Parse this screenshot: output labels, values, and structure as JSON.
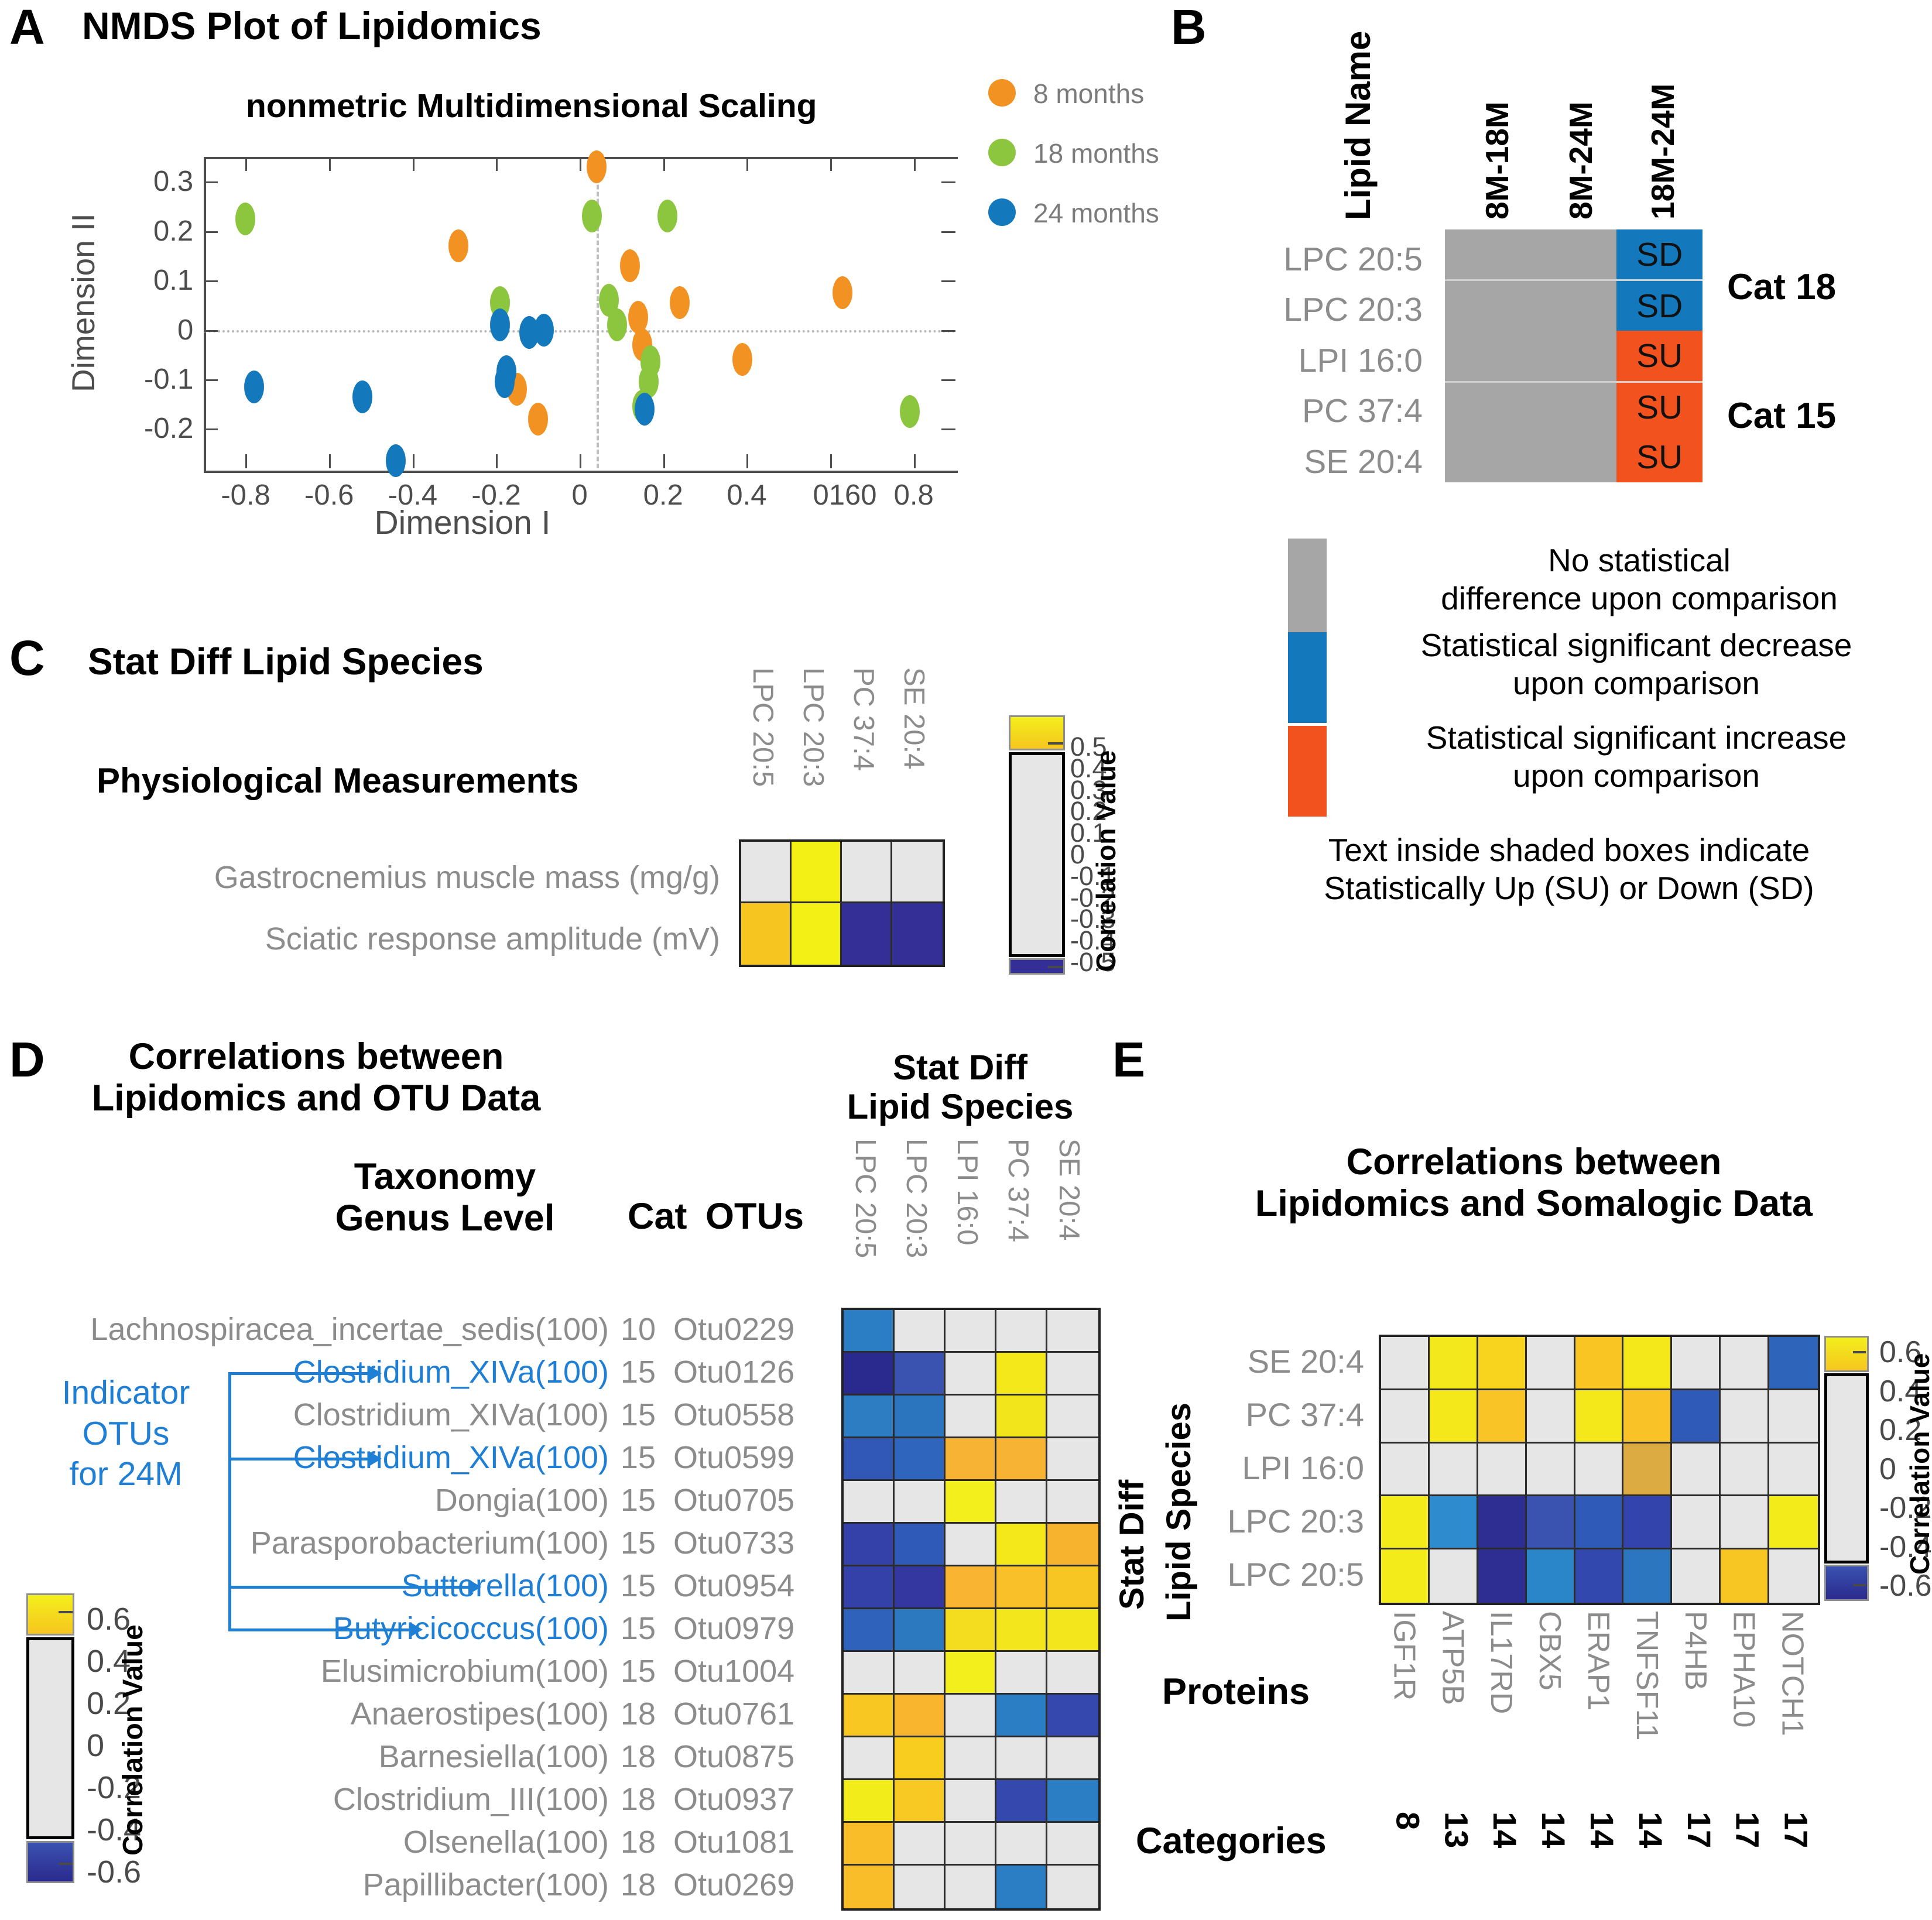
{
  "panels": {
    "a": {
      "letter": "A",
      "title": "NMDS Plot of Lipidomics",
      "subtitle": "nonmetric Multidimensional Scaling",
      "xlabel": "Dimension I",
      "ylabel": "Dimension II",
      "xticks": [
        "-0.8",
        "-0.6",
        "-0.4",
        "-0.2",
        "0",
        "0.2",
        "0.4",
        "0160",
        "0.8"
      ],
      "yticks": [
        "0.3",
        "0.2",
        "0.1",
        "0",
        "-0.1",
        "-0.2"
      ],
      "legend": [
        {
          "label": "8 months",
          "color": "#f29222"
        },
        {
          "label": "18 months",
          "color": "#8cc63e"
        },
        {
          "label": "24 months",
          "color": "#1479bc"
        }
      ]
    },
    "b": {
      "letter": "B",
      "row_header": "Lipid Name",
      "columns": [
        "8M-18M",
        "8M-24M",
        "18M-24M"
      ],
      "rows": [
        {
          "lipid": "LPC 20:5",
          "cells": [
            {
              "v": "",
              "s": "ns"
            },
            {
              "v": "",
              "s": "ns"
            },
            {
              "v": "SD",
              "s": "down"
            }
          ]
        },
        {
          "lipid": "LPC 20:3",
          "cells": [
            {
              "v": "",
              "s": "ns"
            },
            {
              "v": "",
              "s": "ns"
            },
            {
              "v": "SD",
              "s": "down"
            }
          ]
        },
        {
          "lipid": "LPI 16:0",
          "cells": [
            {
              "v": "",
              "s": "ns"
            },
            {
              "v": "",
              "s": "ns"
            },
            {
              "v": "SU",
              "s": "up"
            }
          ]
        },
        {
          "lipid": "PC 37:4",
          "cells": [
            {
              "v": "",
              "s": "ns"
            },
            {
              "v": "",
              "s": "ns"
            },
            {
              "v": "SU",
              "s": "up"
            }
          ]
        },
        {
          "lipid": "SE 20:4",
          "cells": [
            {
              "v": "",
              "s": "ns"
            },
            {
              "v": "",
              "s": "ns"
            },
            {
              "v": "SU",
              "s": "up"
            }
          ]
        }
      ],
      "cat_labels": [
        {
          "text": "Cat 18",
          "row": 0
        },
        {
          "text": "Cat 15",
          "row": 3
        }
      ],
      "legend": [
        {
          "color": "#a6a6a6",
          "text": "No statistical\ndifference upon comparison"
        },
        {
          "color": "#1479bc",
          "text": "Statistical significant decrease\nupon comparison"
        },
        {
          "color": "#f2521d",
          "text": "Statistical significant increase\nupon comparison"
        }
      ],
      "footnote": "Text inside shaded boxes indicate\nStatistically Up (SU) or Down (SD)"
    },
    "c": {
      "letter": "C",
      "title": "Stat Diff Lipid Species",
      "row_group_title": "Physiological Measurements",
      "colorbar_title": "Correlation Value",
      "colorbar_ticks": [
        "0.5",
        "0.4",
        "0.3",
        "0.2",
        "0.1",
        "0",
        "-0.1",
        "-0.2",
        "-0.3",
        "-0.4",
        "-0.5"
      ]
    },
    "d": {
      "letter": "D",
      "title": "Correlations between\nLipidomics and OTU Data",
      "heatmap_title": "Stat Diff\nLipid Species",
      "taxonomy_header": "Taxonomy\nGenus Level",
      "cat_header": "Cat",
      "otu_header": "OTUs",
      "indicator_label": "Indicator\nOTUs\nfor 24M",
      "colorbar_title": "Correlation Value",
      "colorbar_ticks": [
        "0.6",
        "0.4",
        "0.2",
        "0",
        "-0.2",
        "-0.4",
        "-0.6"
      ]
    },
    "e": {
      "letter": "E",
      "title": "Correlations between\nLipidomics and Somalogic Data",
      "ylabel": "Stat Diff\nLipid Species",
      "proteins_label": "Proteins",
      "categories_label": "Categories",
      "colorbar_title": "Correlation Value",
      "colorbar_ticks": [
        "0.6",
        "0.4",
        "0.2",
        "0",
        "-0.2",
        "-0.4",
        "-0.6"
      ]
    }
  },
  "chart_data": [
    {
      "type": "scatter",
      "title": "nonmetric Multidimensional Scaling",
      "xlabel": "Dimension I",
      "ylabel": "Dimension II",
      "xlim": [
        -0.9,
        0.9
      ],
      "ylim": [
        -0.28,
        0.35
      ],
      "grid": false,
      "legend_position": "top-right",
      "series": [
        {
          "name": "8 months",
          "color": "#f29222",
          "points": [
            [
              0.04,
              0.33
            ],
            [
              -0.29,
              0.17
            ],
            [
              0.12,
              0.13
            ],
            [
              0.63,
              0.075
            ],
            [
              0.24,
              0.055
            ],
            [
              0.14,
              0.025
            ],
            [
              0.15,
              -0.03
            ],
            [
              0.39,
              -0.06
            ],
            [
              -0.15,
              -0.12
            ],
            [
              -0.1,
              -0.18
            ]
          ]
        },
        {
          "name": "18 months",
          "color": "#8cc63e",
          "points": [
            [
              -0.8,
              0.225
            ],
            [
              0.03,
              0.23
            ],
            [
              0.21,
              0.23
            ],
            [
              -0.19,
              0.055
            ],
            [
              0.07,
              0.06
            ],
            [
              0.09,
              0.01
            ],
            [
              0.17,
              -0.065
            ],
            [
              0.165,
              -0.105
            ],
            [
              0.15,
              -0.155
            ],
            [
              0.79,
              -0.165
            ]
          ]
        },
        {
          "name": "24 months",
          "color": "#1479bc",
          "points": [
            [
              -0.19,
              0.01
            ],
            [
              -0.12,
              -0.005
            ],
            [
              -0.085,
              0.0
            ],
            [
              -0.78,
              -0.115
            ],
            [
              -0.52,
              -0.135
            ],
            [
              -0.175,
              -0.085
            ],
            [
              -0.18,
              -0.105
            ],
            [
              0.155,
              -0.16
            ],
            [
              -0.44,
              -0.265
            ]
          ]
        }
      ]
    },
    {
      "type": "heatmap",
      "title": "Stat Diff Lipid Species",
      "xlabel": "",
      "ylabel": "Physiological Measurements",
      "columns": [
        "LPC 20:5",
        "LPC 20:3",
        "PC 37:4",
        "SE 20:4"
      ],
      "rows": [
        "Gastrocnemius muscle mass (mg/g)",
        "Sciatic response amplitude (mV)"
      ],
      "colorbar_label": "Correlation Value",
      "clim": [
        -0.5,
        0.5
      ],
      "cells": [
        [
          "#e6e6e6",
          "#f2f015",
          "#e6e6e6",
          "#e6e6e6"
        ],
        [
          "#f6c51f",
          "#f2f015",
          "#342f96",
          "#342f96"
        ]
      ]
    },
    {
      "type": "heatmap",
      "title": "Correlations between Lipidomics and OTU Data",
      "xlabel": "Stat Diff Lipid Species",
      "ylabel": "Taxonomy Genus Level",
      "columns": [
        "LPC 20:5",
        "LPC 20:3",
        "LPI 16:0",
        "PC 37:4",
        "SE 20:4"
      ],
      "colorbar_label": "Correlation Value",
      "clim": [
        -0.6,
        0.6
      ],
      "rows": [
        {
          "taxon": "Lachnospiracea_incertae_sedis(100)",
          "cat": "10",
          "otu": "Otu0229",
          "indicator": false,
          "cells": [
            "#2b7ec4",
            "#e6e6e6",
            "#e6e6e6",
            "#e6e6e6",
            "#e6e6e6"
          ]
        },
        {
          "taxon": "Clostridium_XIVa(100)",
          "cat": "15",
          "otu": "Otu0126",
          "indicator": true,
          "cells": [
            "#2a2a8e",
            "#3a52b0",
            "#e6e6e6",
            "#f5e81a",
            "#e6e6e6"
          ]
        },
        {
          "taxon": "Clostridium_XIVa(100)",
          "cat": "15",
          "otu": "Otu0558",
          "indicator": false,
          "cells": [
            "#2c7dc2",
            "#2a75bd",
            "#e6e6e6",
            "#f3e51c",
            "#e6e6e6"
          ]
        },
        {
          "taxon": "Clostridium_XIVa(100)",
          "cat": "15",
          "otu": "Otu0599",
          "indicator": true,
          "cells": [
            "#3158b7",
            "#2f65bc",
            "#f7b333",
            "#f7b333",
            "#e6e6e6"
          ]
        },
        {
          "taxon": "Dongia(100)",
          "cat": "15",
          "otu": "Otu0705",
          "indicator": false,
          "cells": [
            "#e6e6e6",
            "#e6e6e6",
            "#f3ef1d",
            "#e6e6e6",
            "#e6e6e6"
          ]
        },
        {
          "taxon": "Parasporobacterium(100)",
          "cat": "15",
          "otu": "Otu0733",
          "indicator": false,
          "cells": [
            "#3341a8",
            "#2f5ab8",
            "#e6e6e6",
            "#f5e81a",
            "#f8b32e"
          ]
        },
        {
          "taxon": "Sutterella(100)",
          "cat": "15",
          "otu": "Otu0954",
          "indicator": true,
          "cells": [
            "#3341a8",
            "#33379f",
            "#f9b431",
            "#f9c029",
            "#f8c623"
          ]
        },
        {
          "taxon": "Butyricicoccus(100)",
          "cat": "15",
          "otu": "Otu0979",
          "indicator": true,
          "cells": [
            "#2f62bb",
            "#2c79c0",
            "#f4dc1f",
            "#f4e61d",
            "#f4e61d"
          ]
        },
        {
          "taxon": "Elusimicrobium(100)",
          "cat": "15",
          "otu": "Otu1004",
          "indicator": false,
          "cells": [
            "#e6e6e6",
            "#e6e6e6",
            "#f2ef1c",
            "#e6e6e6",
            "#e6e6e6"
          ]
        },
        {
          "taxon": "Anaerostipes(100)",
          "cat": "18",
          "otu": "Otu0761",
          "indicator": false,
          "cells": [
            "#f9c722",
            "#f9b52e",
            "#e6e6e6",
            "#2b7ec4",
            "#3448ad"
          ]
        },
        {
          "taxon": "Barnesiella(100)",
          "cat": "18",
          "otu": "Otu0875",
          "indicator": false,
          "cells": [
            "#e6e6e6",
            "#f8cd20",
            "#e6e6e6",
            "#e6e6e6",
            "#e6e6e6"
          ]
        },
        {
          "taxon": "Clostridium_III(100)",
          "cat": "18",
          "otu": "Otu0937",
          "indicator": false,
          "cells": [
            "#f3ec1b",
            "#f8c922",
            "#e6e6e6",
            "#3448ad",
            "#2b7ec4"
          ]
        },
        {
          "taxon": "Olsenella(100)",
          "cat": "18",
          "otu": "Otu1081",
          "indicator": false,
          "cells": [
            "#f9bd2a",
            "#e6e6e6",
            "#e6e6e6",
            "#e6e6e6",
            "#e6e6e6"
          ]
        },
        {
          "taxon": "Papillibacter(100)",
          "cat": "18",
          "otu": "Otu0269",
          "indicator": false,
          "cells": [
            "#f9bd2a",
            "#e6e6e6",
            "#e6e6e6",
            "#2b7ec4",
            "#e6e6e6"
          ]
        }
      ]
    },
    {
      "type": "heatmap",
      "title": "Correlations between Lipidomics and Somalogic Data",
      "xlabel": "Proteins",
      "ylabel": "Stat Diff Lipid Species",
      "columns": [
        "IGF1R",
        "ATP5B",
        "IL17RD",
        "CBX5",
        "ERAP1",
        "TNFSF11",
        "P4HB",
        "EPHA10",
        "NOTCH1"
      ],
      "category_row_label": "Categories",
      "categories": [
        "8",
        "13",
        "14",
        "14",
        "14",
        "14",
        "17",
        "17",
        "17"
      ],
      "rows": [
        "SE 20:4",
        "PC 37:4",
        "LPI 16:0",
        "LPC 20:3",
        "LPC 20:5"
      ],
      "colorbar_label": "Correlation Value",
      "clim": [
        -0.6,
        0.6
      ],
      "cells": [
        [
          "#e6e6e6",
          "#f3e81b",
          "#f8d41e",
          "#e6e6e6",
          "#f9c523",
          "#f4e81a",
          "#e6e6e6",
          "#e6e6e6",
          "#2f64bb"
        ],
        [
          "#e6e6e6",
          "#f4e81a",
          "#f9c526",
          "#e6e6e6",
          "#f4e81a",
          "#f9c227",
          "#2f5ab8",
          "#e6e6e6",
          "#e6e6e6"
        ],
        [
          "#e6e6e6",
          "#e6e6e6",
          "#e6e6e6",
          "#e6e6e6",
          "#e6e6e6",
          "#dcab42",
          "#e6e6e6",
          "#e6e6e6",
          "#e6e6e6"
        ],
        [
          "#f3ec1a",
          "#2e8bcd",
          "#2d2d92",
          "#3a52b0",
          "#2f5ab8",
          "#3345ac",
          "#e6e6e6",
          "#e6e6e6",
          "#f3ec1a"
        ],
        [
          "#f3ec1a",
          "#e6e6e6",
          "#2d2d92",
          "#2b85c9",
          "#3348ae",
          "#2c75bf",
          "#e6e6e6",
          "#f8c623",
          "#e6e6e6"
        ]
      ]
    }
  ],
  "c_rows": [
    "Gastrocnemius muscle mass (mg/g)",
    "Sciatic response amplitude (mV)"
  ],
  "c_cols": [
    "LPC 20:5",
    "LPC 20:3",
    "PC 37:4",
    "SE 20:4"
  ],
  "d_cols": [
    "LPC 20:5",
    "LPC 20:3",
    "LPI 16:0",
    "PC 37:4",
    "SE 20:4"
  ],
  "e_rows": [
    "SE 20:4",
    "PC 37:4",
    "LPI 16:0",
    "LPC 20:3",
    "LPC 20:5"
  ],
  "e_cols": [
    "IGF1R",
    "ATP5B",
    "IL17RD",
    "CBX5",
    "ERAP1",
    "TNFSF11",
    "P4HB",
    "EPHA10",
    "NOTCH1"
  ],
  "e_cats": [
    "8",
    "13",
    "14",
    "14",
    "14",
    "14",
    "17",
    "17",
    "17"
  ],
  "colors": {
    "orange8": "#f29222",
    "green18": "#8cc63e",
    "blue24": "#1479bc",
    "ns_grey": "#a6a6a6",
    "sig_down": "#1479bc",
    "sig_up": "#f2521d",
    "cb_neutral": "#e6e6e6",
    "cb_high": "#f5e81a",
    "cb_low": "#342f96",
    "label_grey": "#8c8c8c",
    "indicator_blue": "#1f7fd4"
  }
}
